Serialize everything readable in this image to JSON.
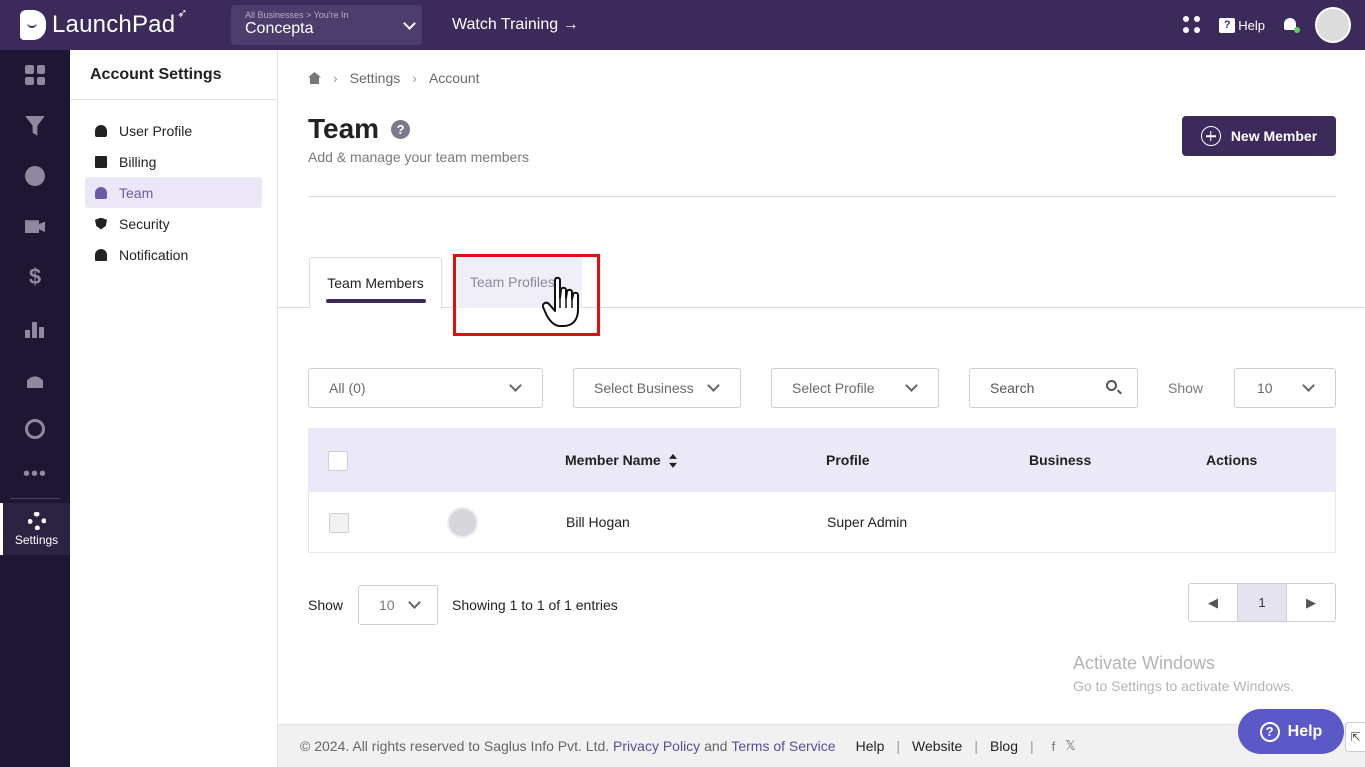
{
  "header": {
    "brand": "LaunchPad",
    "business_meta": "All Businesses > You're In",
    "business_name": "Concepta",
    "watch_training": "Watch Training →",
    "help": "Help"
  },
  "rail": {
    "items": [
      "dashboard-icon",
      "funnel-icon",
      "globe-icon",
      "video-icon",
      "dollar-icon",
      "chart-icon",
      "users-icon",
      "gauge-icon",
      "more-icon"
    ],
    "settings_label": "Settings"
  },
  "subnav": {
    "title": "Account Settings",
    "items": [
      {
        "label": "User Profile",
        "icon": "user-icon"
      },
      {
        "label": "Billing",
        "icon": "billing-icon"
      },
      {
        "label": "Team",
        "icon": "team-icon",
        "active": true
      },
      {
        "label": "Security",
        "icon": "shield-icon"
      },
      {
        "label": "Notification",
        "icon": "bell-icon"
      }
    ]
  },
  "breadcrumb": [
    "Settings",
    "Account"
  ],
  "page": {
    "title": "Team",
    "subtitle": "Add & manage your team members",
    "new_member": "New Member"
  },
  "tabs": {
    "members": "Team Members",
    "profiles": "Team Profiles"
  },
  "filters": {
    "all": "All (0)",
    "business": "Select Business",
    "profile": "Select Profile",
    "search_placeholder": "Search",
    "show_label": "Show",
    "show_value": "10"
  },
  "table": {
    "headers": {
      "name": "Member Name",
      "profile": "Profile",
      "business": "Business",
      "actions": "Actions"
    },
    "rows": [
      {
        "name": "Bill Hogan",
        "profile": "Super Admin",
        "business": "",
        "actions": ""
      }
    ]
  },
  "pagination": {
    "show_label": "Show",
    "show_value": "10",
    "entries": "Showing 1 to 1 of 1 entries",
    "prev": "◀",
    "page": "1",
    "next": "▶"
  },
  "watermark": {
    "line1": "Activate Windows",
    "line2": "Go to Settings to activate Windows."
  },
  "footer": {
    "copyright": "©  2024. All rights reserved to Saglus Info Pvt. Ltd.",
    "privacy": "Privacy Policy",
    "and": "and",
    "terms": "Terms of Service",
    "help": "Help",
    "website": "Website",
    "blog": "Blog",
    "sep": "|",
    "facebook": "f",
    "x": "𝕏"
  },
  "help_fab": "Help",
  "colors": {
    "topbar": "#3b2a5a",
    "rail": "#1f1633",
    "accent": "#6b5ba6",
    "table_head": "#ebe8f8",
    "highlight": "#e01010"
  }
}
